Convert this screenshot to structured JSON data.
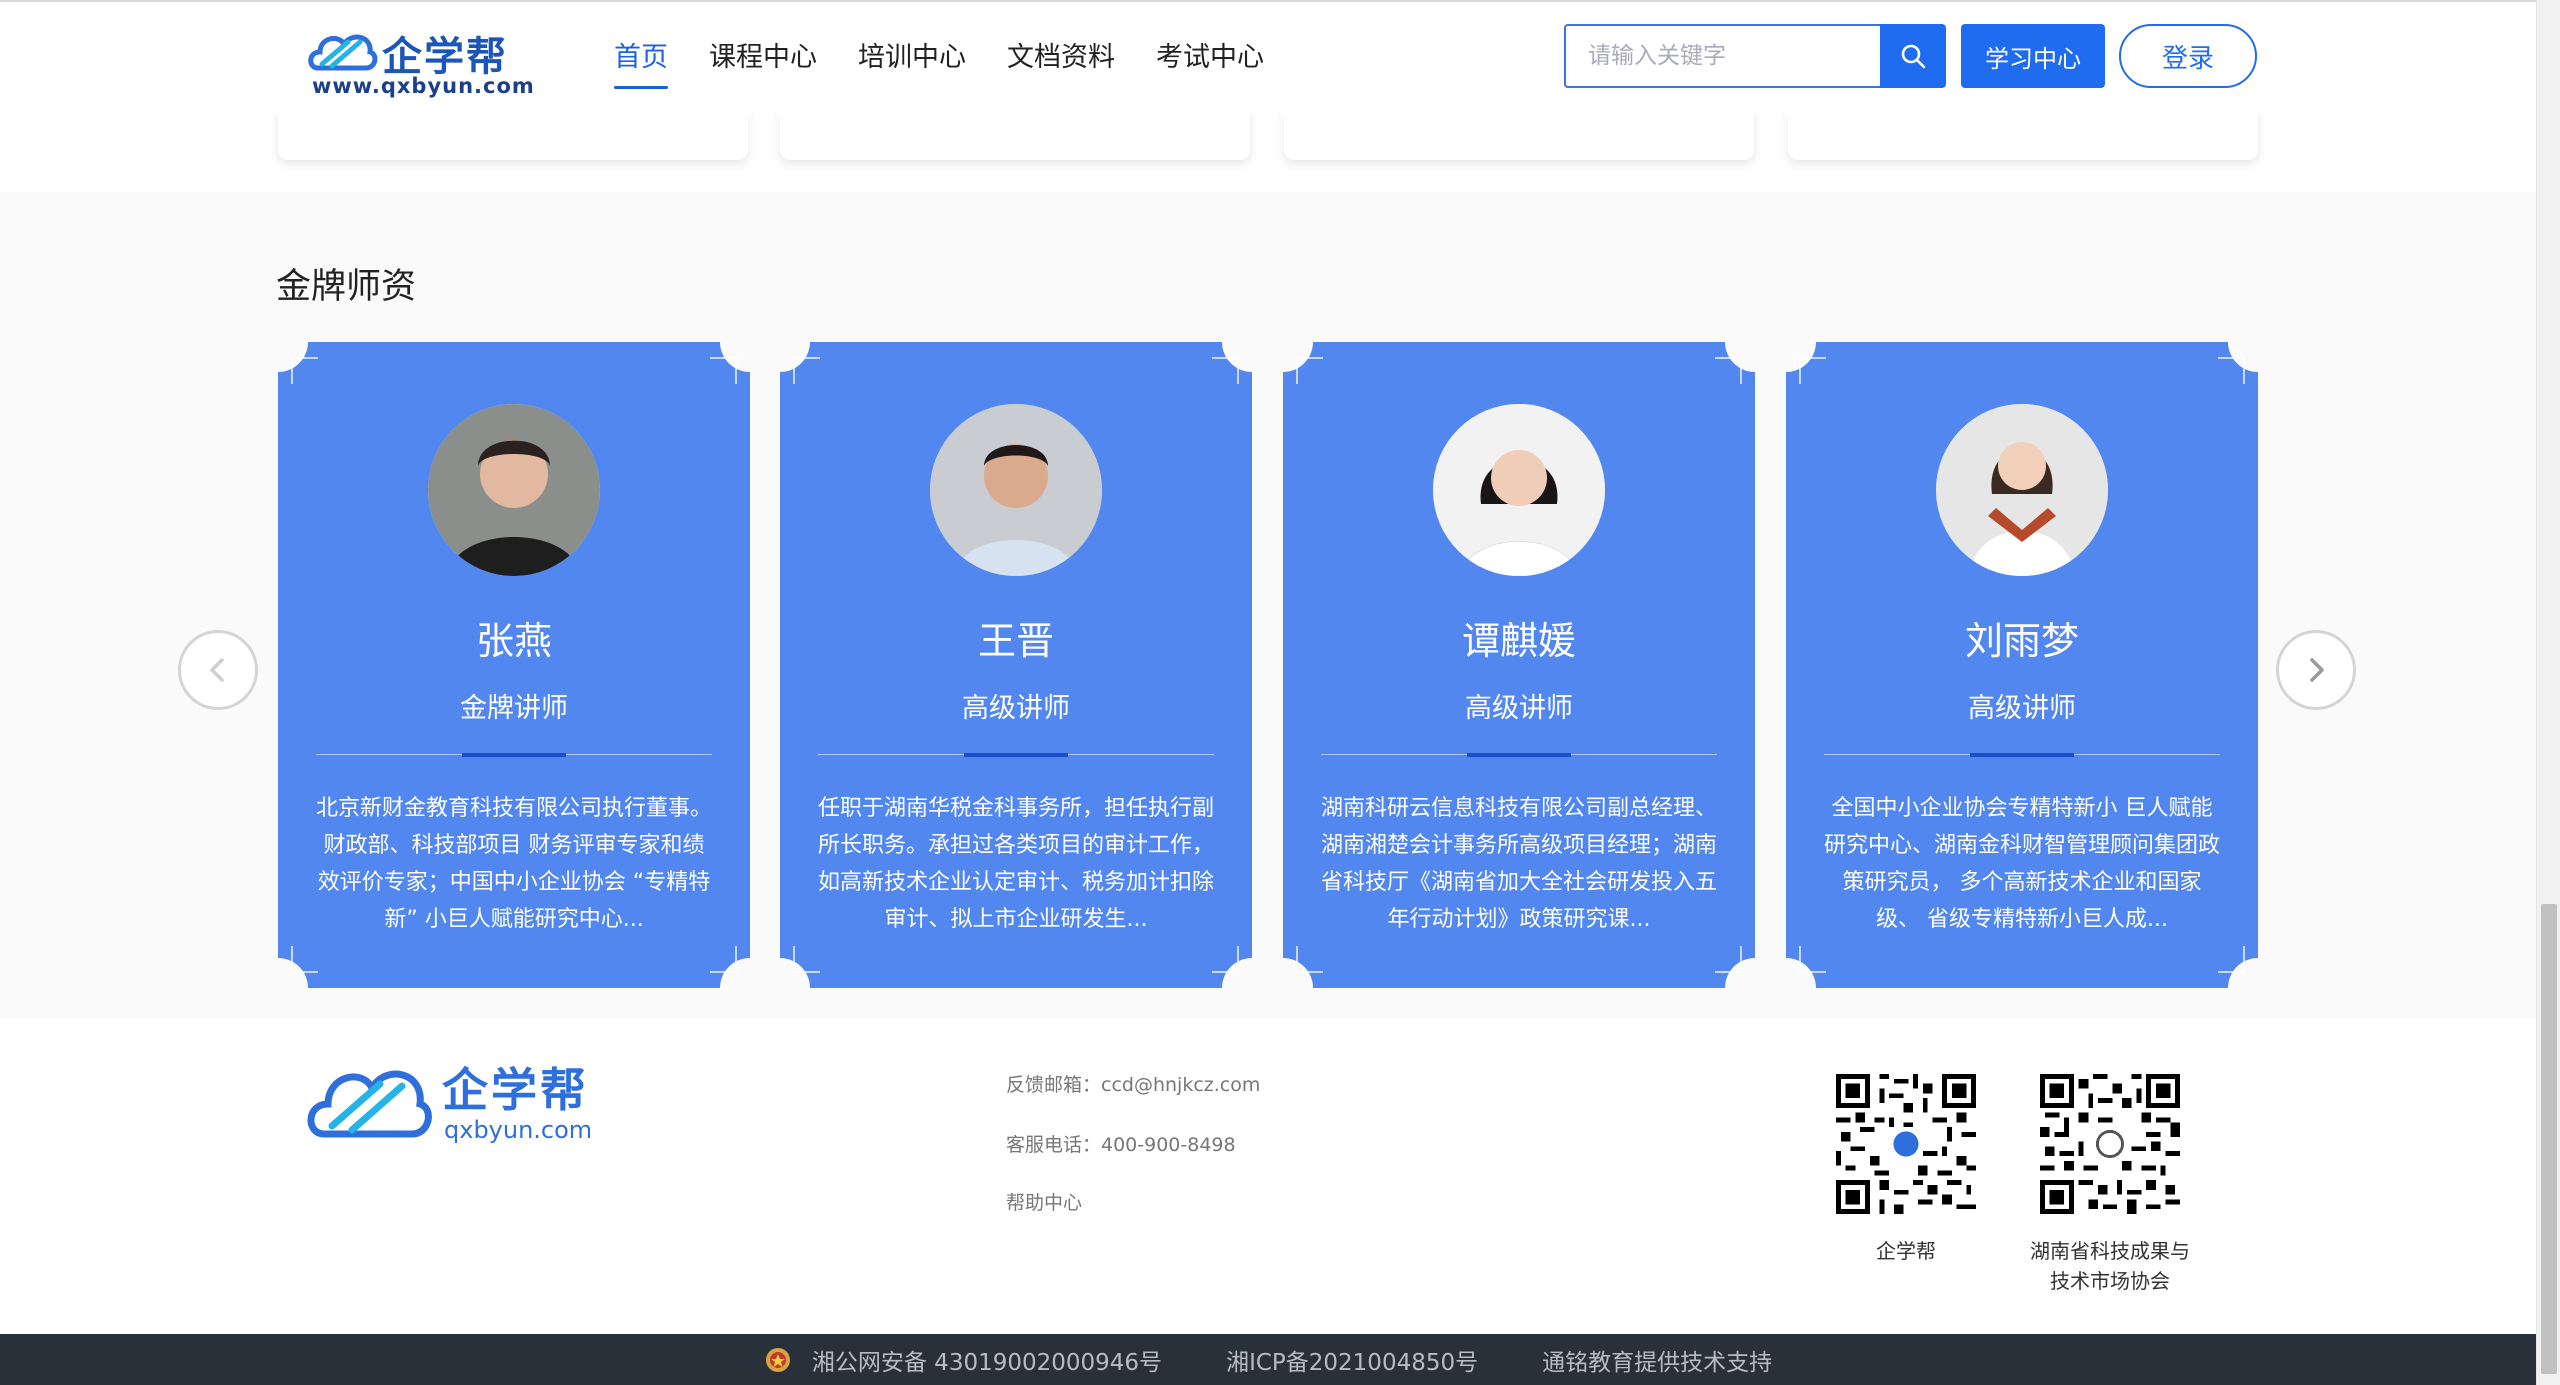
{
  "header": {
    "logo_text": "企学帮",
    "logo_url": "www.qxbyun.com",
    "nav": [
      "首页",
      "课程中心",
      "培训中心",
      "文档资料",
      "考试中心"
    ],
    "active_nav": "首页",
    "search_placeholder": "请输入关键字",
    "study_center": "学习中心",
    "login": "登录"
  },
  "teachers_section": {
    "title": "金牌师资",
    "teachers": [
      {
        "name": "张燕",
        "title": "金牌讲师",
        "description": "北京新财金教育科技有限公司执行董事。财政部、科技部项目 财务评审专家和绩效评价专家；中国中小企业协会 “专精特新” 小巨人赋能研究中心..."
      },
      {
        "name": "王晋",
        "title": "高级讲师",
        "description": "任职于湖南华税金科事务所，担任执行副所长职务。承担过各类项目的审计工作，如高新技术企业认定审计、税务加计扣除审计、拟上市企业研发生..."
      },
      {
        "name": "谭麒媛",
        "title": "高级讲师",
        "description": "湖南科研云信息科技有限公司副总经理、湖南湘楚会计事务所高级项目经理；湖南省科技厅《湖南省加大全社会研发投入五年行动计划》政策研究课..."
      },
      {
        "name": "刘雨梦",
        "title": "高级讲师",
        "description": "全国中小企业协会专精特新小 巨人赋能研究中心、湖南金科财智管理顾问集团政策研究员， 多个高新技术企业和国家级、 省级专精特新小巨人成..."
      }
    ]
  },
  "footer": {
    "logo_text": "企学帮",
    "logo_url": "qxbyun.com",
    "email": "反馈邮箱：ccd@hnjkcz.com",
    "phone": "客服电话：400-900-8498",
    "help": "帮助中心",
    "qr_codes": [
      {
        "label": "企学帮"
      },
      {
        "label_line1": "湖南省科技成果与",
        "label_line2": "技术市场协会"
      }
    ],
    "bottom": {
      "police": "湘公网安备 43019002000946号",
      "icp": "湘ICP备2021004850号",
      "support": "通铭教育提供技术支持"
    }
  },
  "colors": {
    "primary": "#1f6cf0",
    "card_blue": "#5287ef",
    "footer_bar": "#283039"
  }
}
